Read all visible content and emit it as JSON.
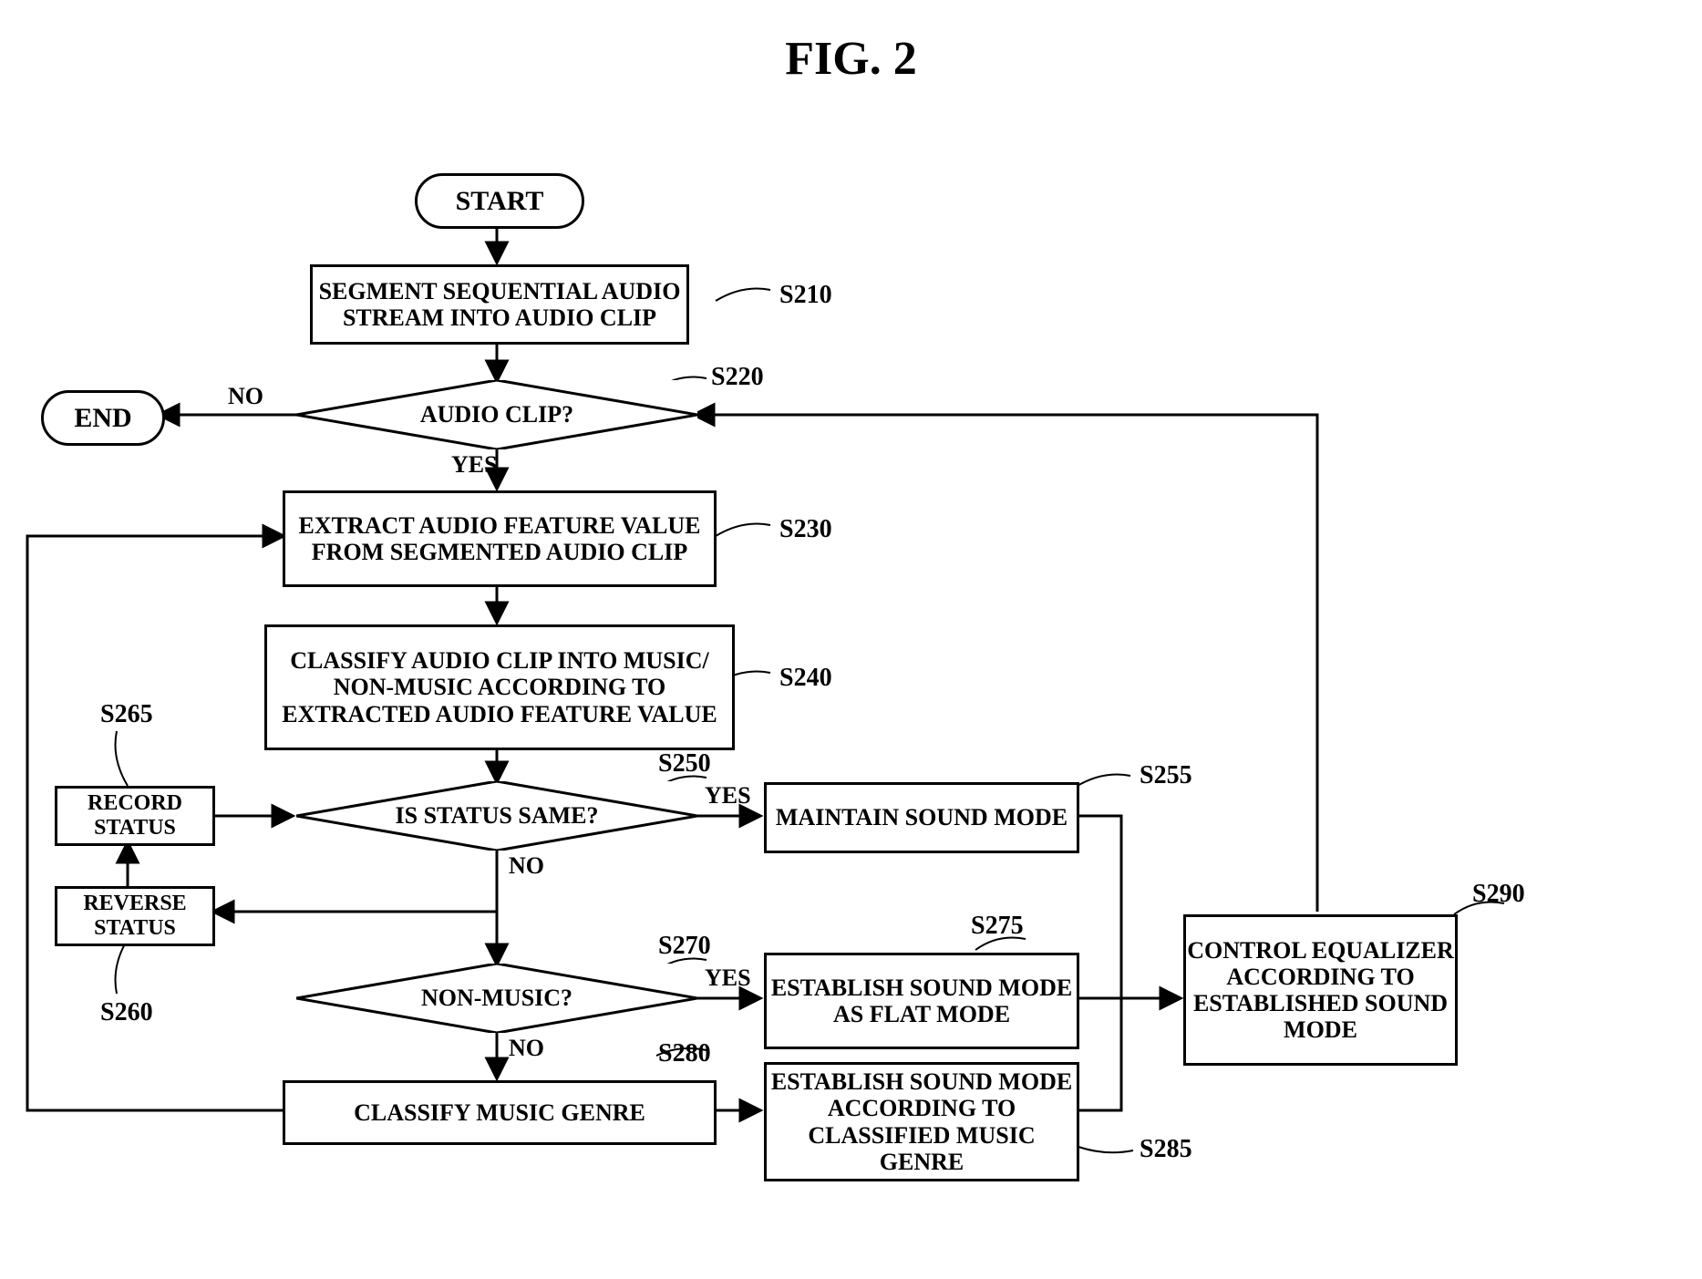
{
  "title": "FIG. 2",
  "nodes": {
    "start": "START",
    "end": "END",
    "s210": "SEGMENT SEQUENTIAL AUDIO STREAM INTO AUDIO CLIP",
    "s220": "AUDIO CLIP?",
    "s230": "EXTRACT AUDIO FEATURE VALUE FROM SEGMENTED AUDIO CLIP",
    "s240": "CLASSIFY AUDIO CLIP INTO MUSIC/ NON-MUSIC ACCORDING TO EXTRACTED AUDIO FEATURE VALUE",
    "s250": "IS STATUS SAME?",
    "s255": "MAINTAIN SOUND MODE",
    "s260": "REVERSE STATUS",
    "s265": "RECORD STATUS",
    "s270": "NON-MUSIC?",
    "s275": "ESTABLISH SOUND MODE AS FLAT MODE",
    "s280": "CLASSIFY MUSIC GENRE",
    "s285": "ESTABLISH SOUND MODE ACCORDING TO CLASSIFIED MUSIC GENRE",
    "s290": "CONTROL EQUALIZER ACCORDING TO ESTABLISHED SOUND MODE"
  },
  "tags": {
    "s210": "S210",
    "s220": "S220",
    "s230": "S230",
    "s240": "S240",
    "s250": "S250",
    "s255": "S255",
    "s260": "S260",
    "s265": "S265",
    "s270": "S270",
    "s275": "S275",
    "s280": "S280",
    "s285": "S285",
    "s290": "S290"
  },
  "edges": {
    "yes": "YES",
    "no": "NO"
  },
  "chart_data": {
    "type": "flowchart",
    "nodes": [
      {
        "id": "start",
        "kind": "terminator",
        "label": "START"
      },
      {
        "id": "S210",
        "kind": "process",
        "label": "SEGMENT SEQUENTIAL AUDIO STREAM INTO AUDIO CLIP"
      },
      {
        "id": "S220",
        "kind": "decision",
        "label": "AUDIO CLIP?"
      },
      {
        "id": "end",
        "kind": "terminator",
        "label": "END"
      },
      {
        "id": "S230",
        "kind": "process",
        "label": "EXTRACT AUDIO FEATURE VALUE FROM SEGMENTED AUDIO CLIP"
      },
      {
        "id": "S240",
        "kind": "process",
        "label": "CLASSIFY AUDIO CLIP INTO MUSIC/ NON-MUSIC ACCORDING TO EXTRACTED AUDIO FEATURE VALUE"
      },
      {
        "id": "S250",
        "kind": "decision",
        "label": "IS STATUS SAME?"
      },
      {
        "id": "S255",
        "kind": "process",
        "label": "MAINTAIN SOUND MODE"
      },
      {
        "id": "S260",
        "kind": "process",
        "label": "REVERSE STATUS"
      },
      {
        "id": "S265",
        "kind": "process",
        "label": "RECORD STATUS"
      },
      {
        "id": "S270",
        "kind": "decision",
        "label": "NON-MUSIC?"
      },
      {
        "id": "S275",
        "kind": "process",
        "label": "ESTABLISH SOUND MODE AS FLAT MODE"
      },
      {
        "id": "S280",
        "kind": "process",
        "label": "CLASSIFY MUSIC GENRE"
      },
      {
        "id": "S285",
        "kind": "process",
        "label": "ESTABLISH SOUND MODE ACCORDING TO CLASSIFIED MUSIC GENRE"
      },
      {
        "id": "S290",
        "kind": "process",
        "label": "CONTROL EQUALIZER ACCORDING TO ESTABLISHED SOUND MODE"
      }
    ],
    "edges": [
      {
        "from": "start",
        "to": "S210"
      },
      {
        "from": "S210",
        "to": "S220"
      },
      {
        "from": "S220",
        "to": "end",
        "label": "NO"
      },
      {
        "from": "S220",
        "to": "S230",
        "label": "YES"
      },
      {
        "from": "S230",
        "to": "S240"
      },
      {
        "from": "S240",
        "to": "S250"
      },
      {
        "from": "S250",
        "to": "S255",
        "label": "YES"
      },
      {
        "from": "S250",
        "to": "S270",
        "label": "NO",
        "via": "S260"
      },
      {
        "from": "S260",
        "to": "S265"
      },
      {
        "from": "S265",
        "to": "S230"
      },
      {
        "from": "S270",
        "to": "S275",
        "label": "YES"
      },
      {
        "from": "S270",
        "to": "S280",
        "label": "NO"
      },
      {
        "from": "S280",
        "to": "S285"
      },
      {
        "from": "S255",
        "to": "S290"
      },
      {
        "from": "S275",
        "to": "S290"
      },
      {
        "from": "S285",
        "to": "S290"
      },
      {
        "from": "S290",
        "to": "S220"
      },
      {
        "from": "S280",
        "to": "S230",
        "note": "loop back left"
      }
    ]
  }
}
